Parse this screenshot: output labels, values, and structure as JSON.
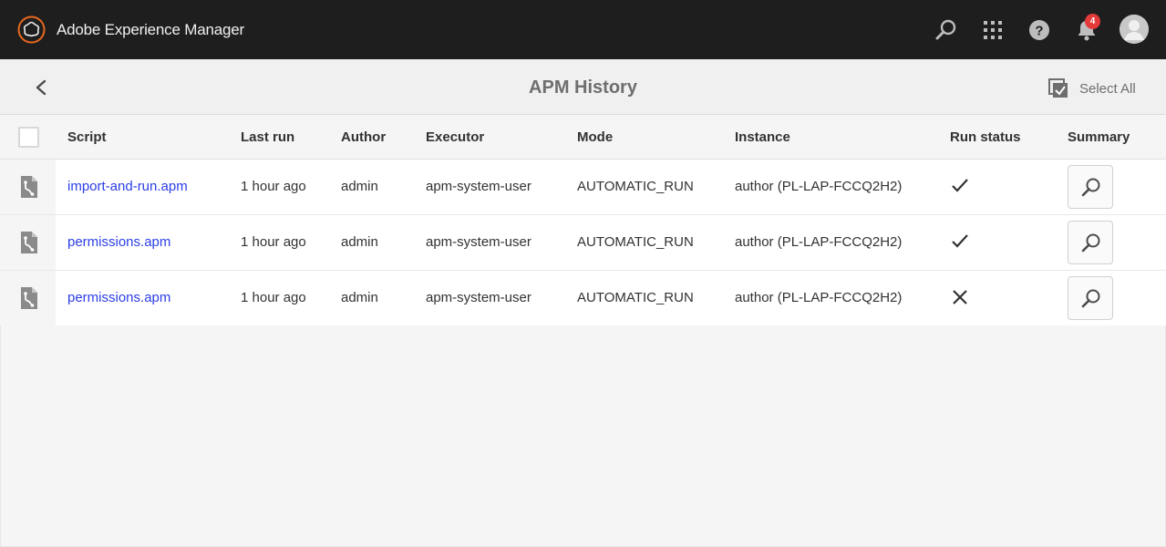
{
  "shell": {
    "app_title": "Adobe Experience Manager",
    "notification_count": "4",
    "icons": [
      "adobe-logo-icon",
      "search-icon",
      "apps-grid-icon",
      "help-icon",
      "bell-icon",
      "user-avatar-icon"
    ]
  },
  "actionbar": {
    "title": "APM History",
    "select_all_label": "Select All"
  },
  "table": {
    "headers": {
      "script": "Script",
      "last_run": "Last run",
      "author": "Author",
      "executor": "Executor",
      "mode": "Mode",
      "instance": "Instance",
      "run_status": "Run status",
      "summary": "Summary"
    },
    "rows": [
      {
        "script": "import-and-run.apm",
        "last_run": "1 hour ago",
        "author": "admin",
        "executor": "apm-system-user",
        "mode": "AUTOMATIC_RUN",
        "instance": "author (PL-LAP-FCCQ2H2)",
        "status": "success"
      },
      {
        "script": "permissions.apm",
        "last_run": "1 hour ago",
        "author": "admin",
        "executor": "apm-system-user",
        "mode": "AUTOMATIC_RUN",
        "instance": "author (PL-LAP-FCCQ2H2)",
        "status": "success"
      },
      {
        "script": "permissions.apm",
        "last_run": "1 hour ago",
        "author": "admin",
        "executor": "apm-system-user",
        "mode": "AUTOMATIC_RUN",
        "instance": "author (PL-LAP-FCCQ2H2)",
        "status": "failure"
      }
    ]
  },
  "colors": {
    "shell_bg": "#1e1e1e",
    "link": "#2b3ee5",
    "badge": "#e33a3a",
    "logo_accent": "#e8681e"
  }
}
